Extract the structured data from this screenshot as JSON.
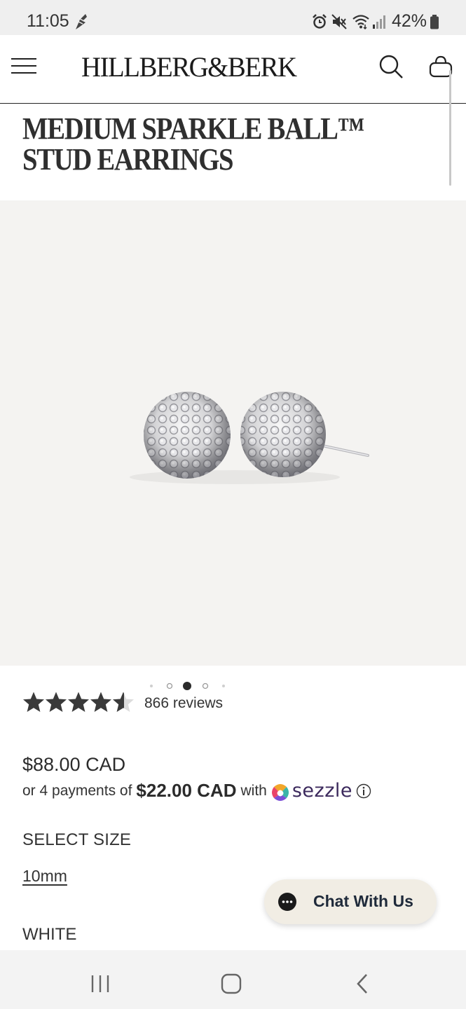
{
  "status_bar": {
    "time": "11:05",
    "battery": "42%",
    "icons": [
      "fan-app-icon",
      "alarm-icon",
      "mute-icon",
      "wifi-icon",
      "signal-icon",
      "battery-icon"
    ]
  },
  "header": {
    "brand": "HILLBERG&BERK",
    "icons": [
      "menu-icon",
      "search-icon",
      "shopping-bag-icon"
    ]
  },
  "product": {
    "title": "MEDIUM SPARKLE BALL™ STUD EARRINGS",
    "image_alt_icon": "earrings-photo",
    "carousel": {
      "total": 5,
      "active": 3
    },
    "rating": {
      "value": 4.5,
      "max": 5,
      "reviews_label": "866 reviews"
    },
    "price": "$88.00 CAD",
    "installments": {
      "prefix": "or 4 payments of",
      "amount": "$22.00 CAD",
      "suffix": "with",
      "provider": "sezzle"
    },
    "select_size_label": "SELECT SIZE",
    "size_option": "10mm",
    "color_label": "WHITE"
  },
  "chat": {
    "label": "Chat With Us"
  },
  "colors": {
    "image_bg": "#f4f3f1",
    "star": "#3a3a3a",
    "chat_bg": "#f1ede4",
    "sezzle_purple": "#3c2a5d"
  },
  "nav_bar": {
    "icons": [
      "recent-apps-icon",
      "home-icon",
      "back-icon"
    ]
  }
}
